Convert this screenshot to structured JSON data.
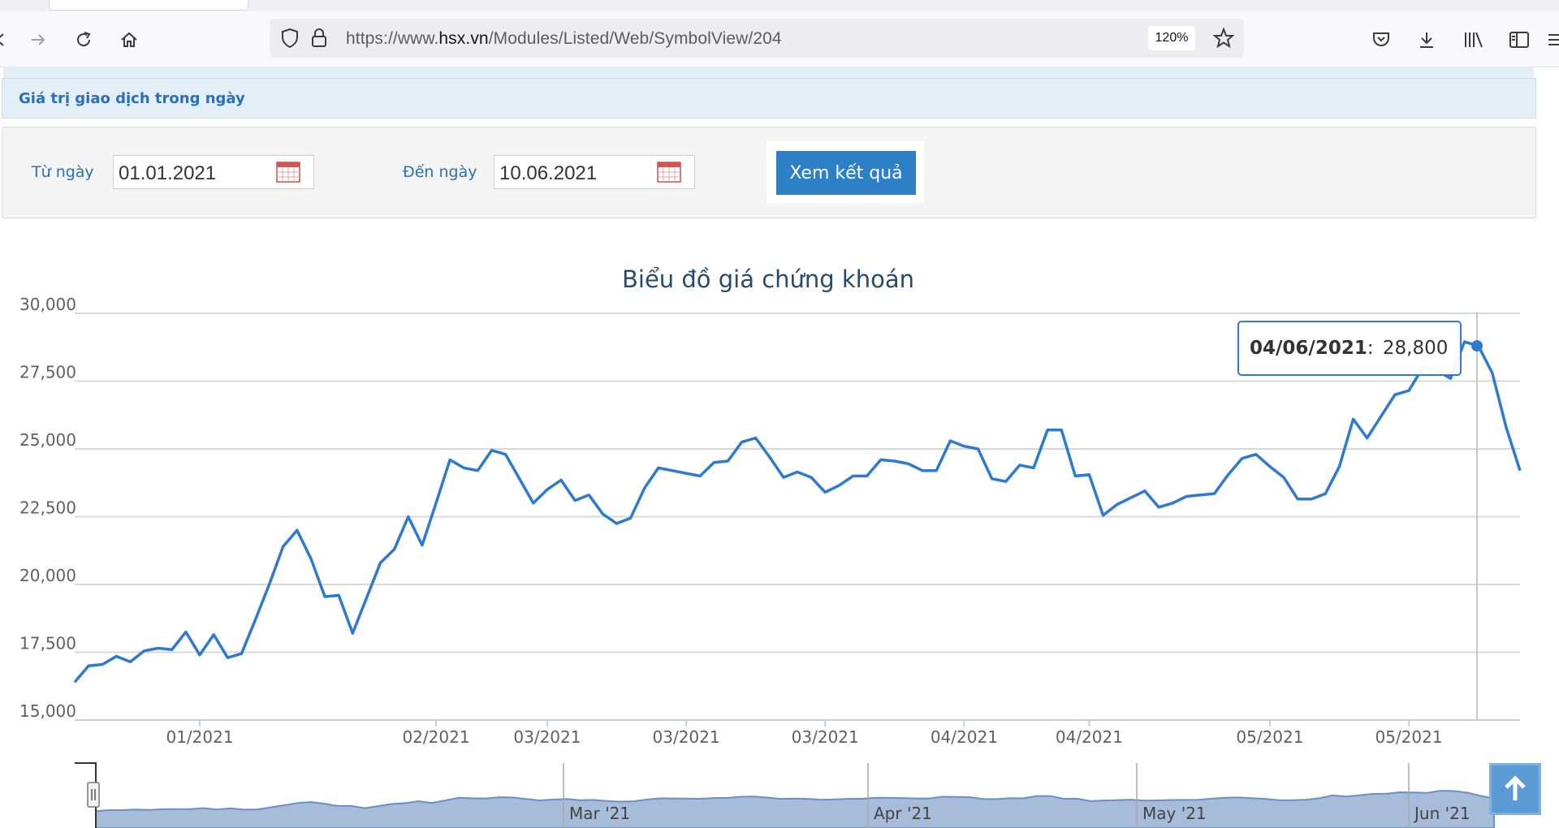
{
  "browser": {
    "url_prefix": "https://www.",
    "url_host": "hsx.vn",
    "url_path": "/Modules/Listed/Web/SymbolView/204",
    "zoom": "120%"
  },
  "page": {
    "section_title": "Giá trị giao dịch trong ngày",
    "from_label": "Từ ngày",
    "from_value": "01.01.2021",
    "to_label": "Đến ngày",
    "to_value": "10.06.2021",
    "submit_label": "Xem kết quả"
  },
  "chart_data": {
    "type": "line",
    "title": "Biểu đồ giá chứng khoán",
    "ylim": [
      15000,
      30000
    ],
    "y_ticks": [
      "30,000",
      "27,500",
      "25,000",
      "22,500",
      "20,000",
      "17,500",
      "15,000"
    ],
    "x_ticks": [
      "01/2021",
      "02/2021",
      "03/2021",
      "03/2021",
      "03/2021",
      "04/2021",
      "04/2021",
      "05/2021",
      "05/2021"
    ],
    "series": [
      {
        "color": "#2e7ad1",
        "values": [
          16400,
          17000,
          17050,
          17350,
          17150,
          17550,
          17650,
          17600,
          18250,
          17400,
          18150,
          17300,
          17450,
          18700,
          20000,
          21400,
          22000,
          20950,
          19550,
          19600,
          18200,
          19500,
          20800,
          21300,
          22500,
          21450,
          23000,
          24600,
          24300,
          24200,
          24950,
          24800,
          23900,
          23000,
          23500,
          23850,
          23100,
          23300,
          22600,
          22250,
          22450,
          23550,
          24300,
          24200,
          24100,
          24000,
          24500,
          24550,
          25250,
          25400,
          24700,
          23950,
          24150,
          23950,
          23400,
          23650,
          24000,
          24000,
          24600,
          24550,
          24450,
          24200,
          24200,
          25300,
          25100,
          25000,
          23900,
          23800,
          24400,
          24300,
          25700,
          25700,
          24000,
          24050,
          22550,
          22950,
          23200,
          23450,
          22850,
          23000,
          23250,
          23300,
          23350,
          24050,
          24650,
          24800,
          24350,
          23950,
          23150,
          23150,
          23350,
          24350,
          26100,
          25400,
          26200,
          27000,
          27150,
          28000,
          27900,
          27600,
          28950,
          28800,
          27800,
          25800,
          24200
        ]
      }
    ],
    "tooltip": {
      "date": "04/06/2021",
      "value": "28,800"
    },
    "navigator_labels": [
      "Mar '21",
      "Apr '21",
      "May '21",
      "Jun '21"
    ]
  }
}
